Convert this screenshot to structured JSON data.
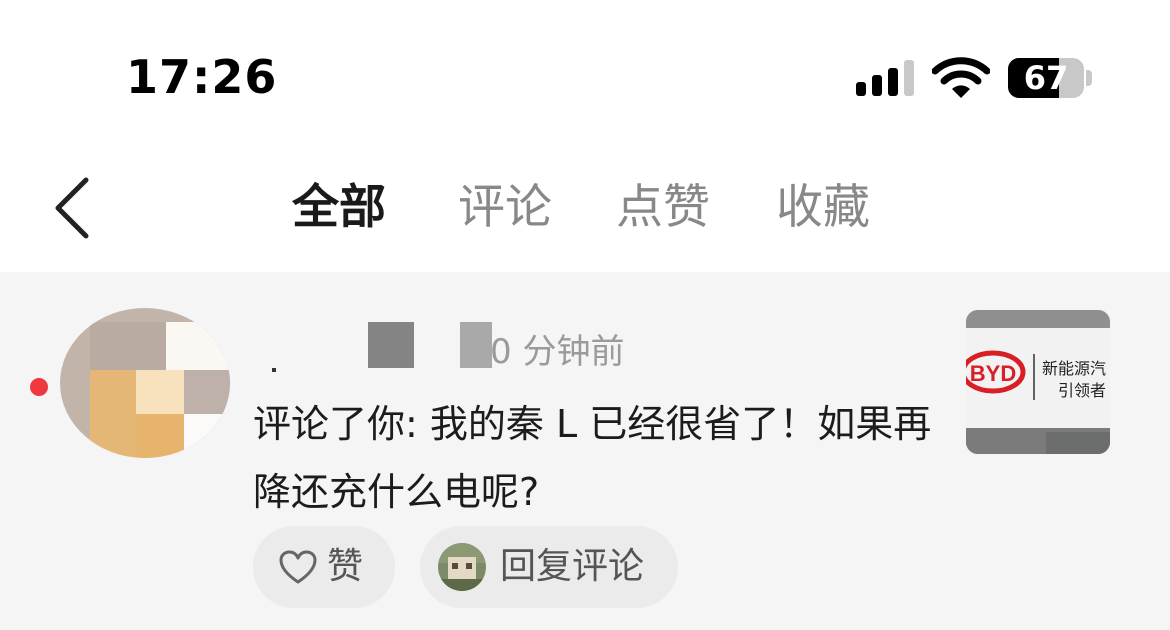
{
  "status_bar": {
    "time": "17:26",
    "battery_level": "67",
    "battery_fraction": 0.67,
    "signal_bars_active": 3,
    "icons": [
      "signal-icon",
      "wifi-icon",
      "battery-icon"
    ]
  },
  "nav": {
    "back_icon": "chevron-left-icon",
    "tabs": [
      {
        "label": "全部",
        "active": true
      },
      {
        "label": "评论",
        "active": false
      },
      {
        "label": "点赞",
        "active": false
      },
      {
        "label": "收藏",
        "active": false
      }
    ]
  },
  "notification": {
    "time_ago": "0 分钟前",
    "comment": "评论了你: 我的秦 L 已经很省了！如果再降还充什么电呢?",
    "unread": true,
    "unread_color": "#f0393e",
    "like_label": "赞",
    "reply_label": "回复评论",
    "thumbnail_logo": "BYD",
    "thumbnail_text_line1": "新能源汽",
    "thumbnail_text_line2": "引领者"
  }
}
